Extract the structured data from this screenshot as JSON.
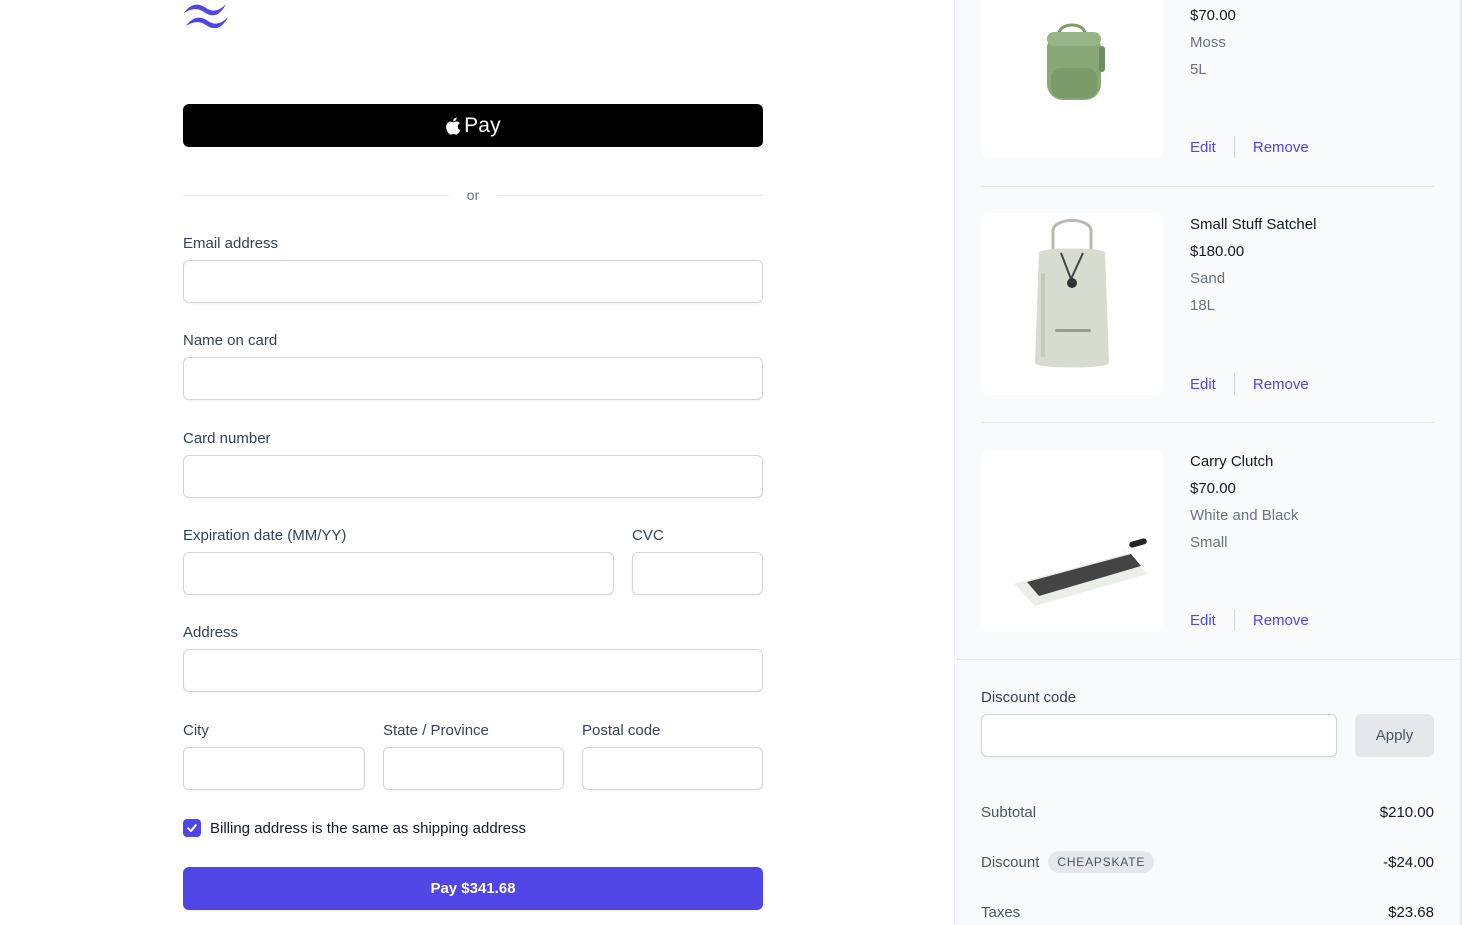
{
  "checkout": {
    "apple_pay_label": "Pay",
    "divider_text": "or",
    "fields": {
      "email_label": "Email address",
      "name_label": "Name on card",
      "card_label": "Card number",
      "expiration_label": "Expiration date (MM/YY)",
      "cvc_label": "CVC",
      "address_label": "Address",
      "city_label": "City",
      "state_label": "State / Province",
      "postal_label": "Postal code"
    },
    "billing_same_label": "Billing address is the same as shipping address",
    "billing_same_checked": true,
    "pay_button_label": "Pay $341.68"
  },
  "cart": {
    "items": [
      {
        "name": "",
        "price": "$70.00",
        "color": "Moss",
        "size": "5L",
        "edit_label": "Edit",
        "remove_label": "Remove"
      },
      {
        "name": "Small Stuff Satchel",
        "price": "$180.00",
        "color": "Sand",
        "size": "18L",
        "edit_label": "Edit",
        "remove_label": "Remove"
      },
      {
        "name": "Carry Clutch",
        "price": "$70.00",
        "color": "White and Black",
        "size": "Small",
        "edit_label": "Edit",
        "remove_label": "Remove"
      }
    ]
  },
  "discount": {
    "label": "Discount code",
    "apply_label": "Apply"
  },
  "summary": {
    "subtotal_label": "Subtotal",
    "subtotal_value": "$210.00",
    "discount_label": "Discount",
    "discount_code": "CHEAPSKATE",
    "discount_value": "-$24.00",
    "taxes_label": "Taxes",
    "taxes_value": "$23.68"
  },
  "colors": {
    "accent": "#4f46e5",
    "apple_pay_bg": "#000000",
    "panel_bg": "#f9fafb"
  }
}
